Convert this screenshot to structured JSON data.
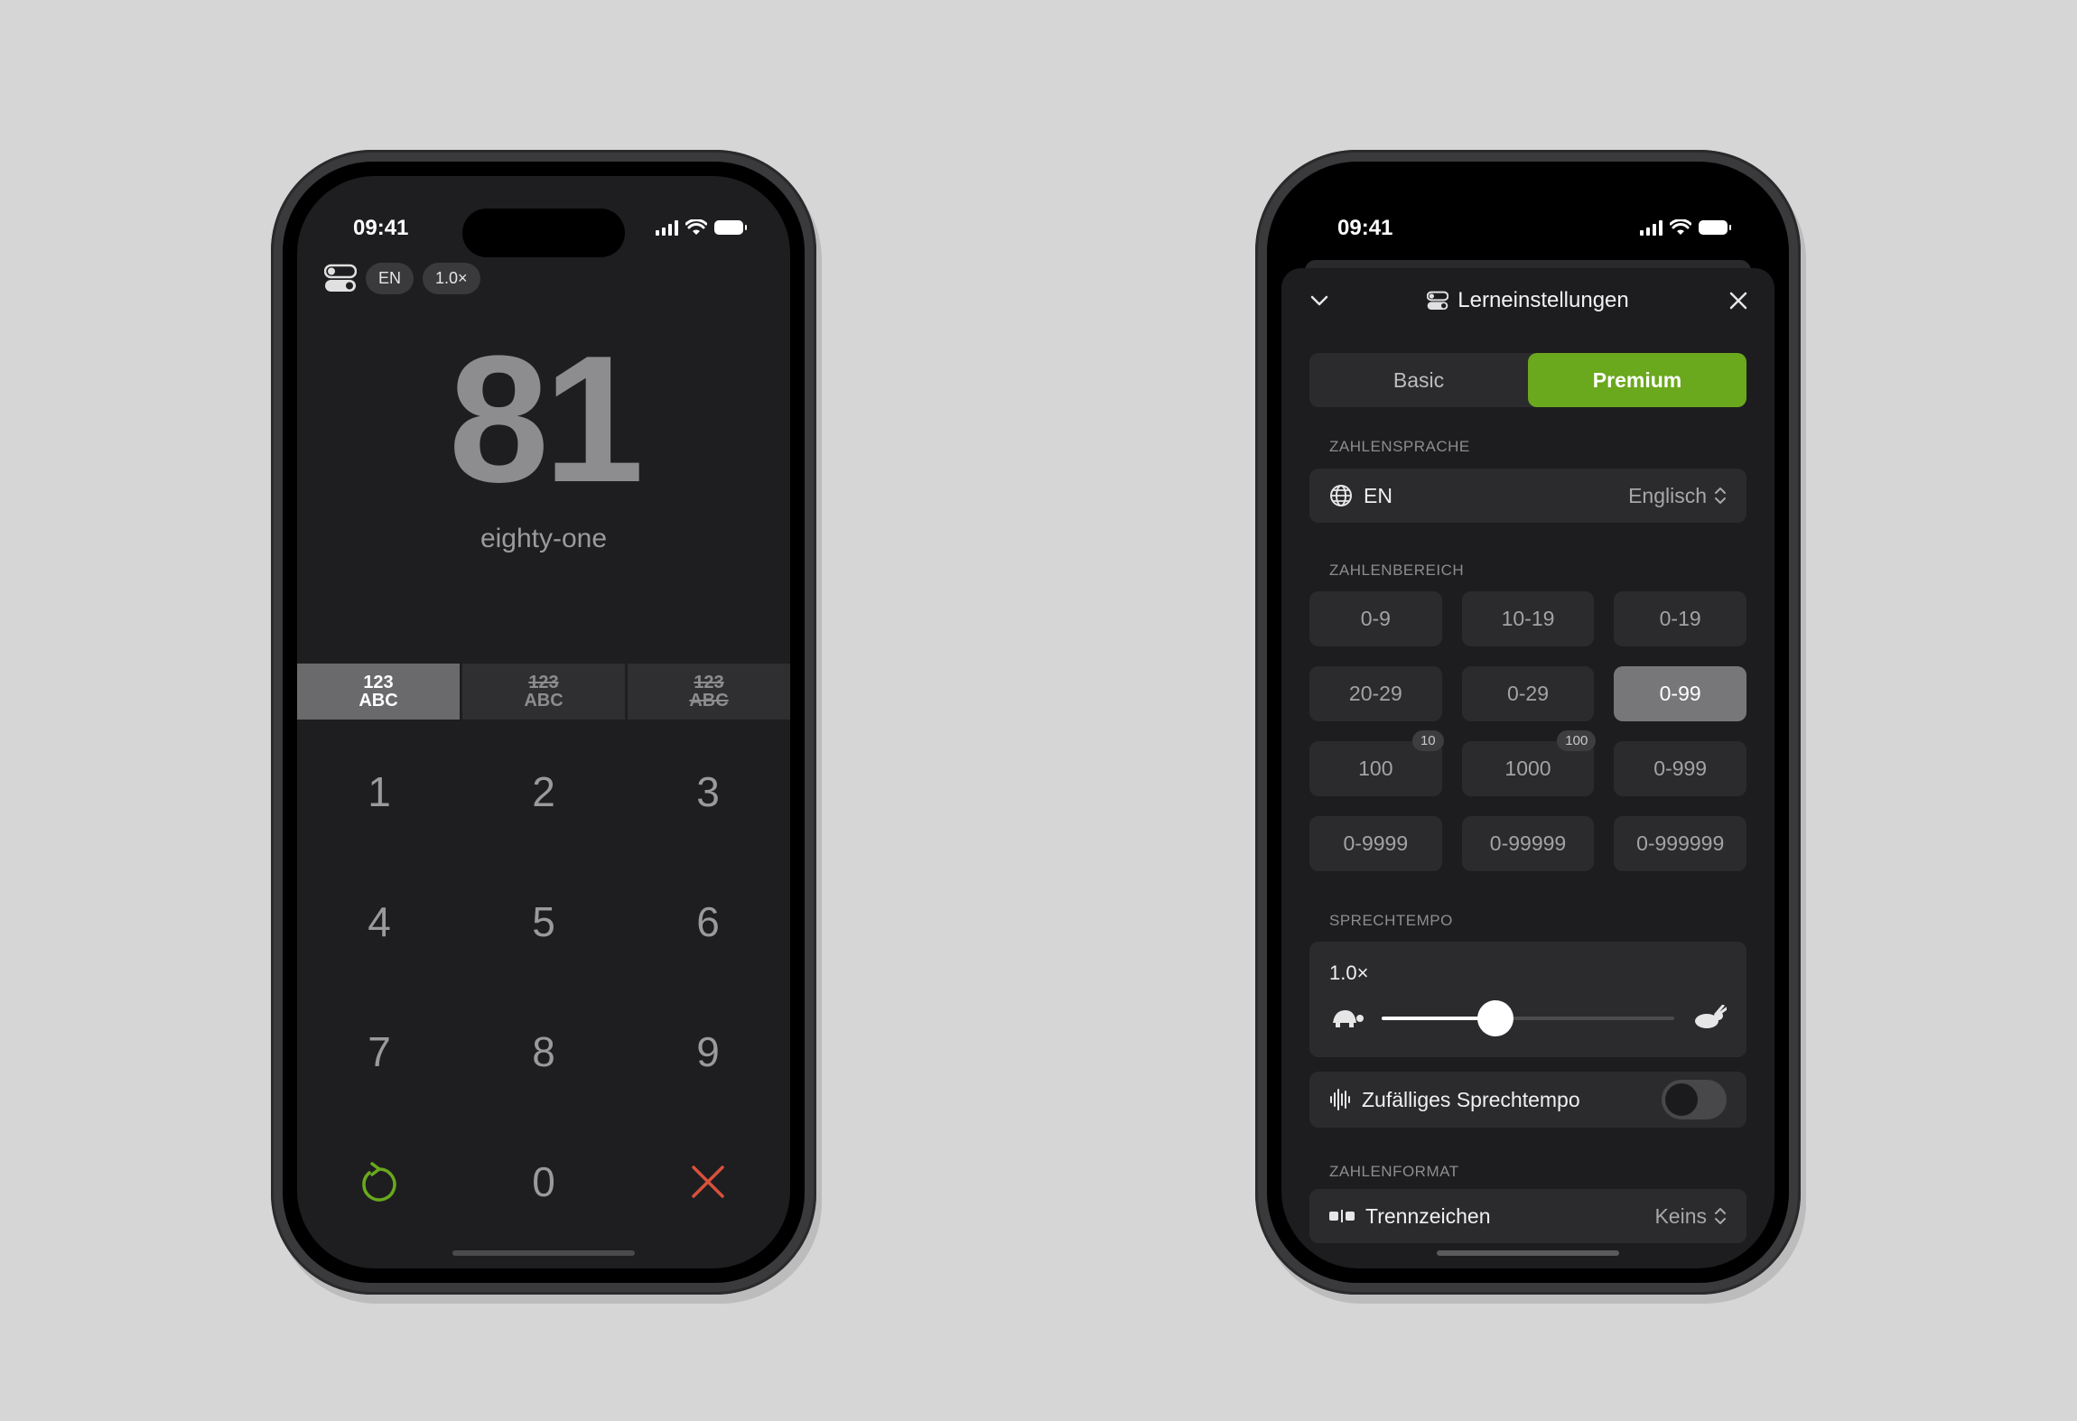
{
  "left_phone": {
    "status": {
      "time": "09:41"
    },
    "top_controls": {
      "lang": "EN",
      "speed": "1.0×"
    },
    "number": "81",
    "number_words": "eighty-one",
    "modes": [
      {
        "top": "123",
        "bottom": "ABC",
        "top_strike": false,
        "bottom_strike": false,
        "active": true
      },
      {
        "top": "123",
        "bottom": "ABC",
        "top_strike": true,
        "bottom_strike": false,
        "active": false
      },
      {
        "top": "123",
        "bottom": "ABC",
        "top_strike": true,
        "bottom_strike": true,
        "active": false
      }
    ],
    "keys": [
      "1",
      "2",
      "3",
      "4",
      "5",
      "6",
      "7",
      "8",
      "9",
      "0"
    ]
  },
  "right_phone": {
    "status": {
      "time": "09:41"
    },
    "sheet_title": "Lerneinstellungen",
    "segments": [
      "Basic",
      "Premium"
    ],
    "active_segment": "Premium",
    "section_language": "ZAHLENSPRACHE",
    "language_code": "EN",
    "language_name": "Englisch",
    "section_range": "ZAHLENBEREICH",
    "ranges": [
      {
        "label": "0-9",
        "badge": ""
      },
      {
        "label": "10-19",
        "badge": ""
      },
      {
        "label": "0-19",
        "badge": ""
      },
      {
        "label": "20-29",
        "badge": ""
      },
      {
        "label": "0-29",
        "badge": ""
      },
      {
        "label": "0-99",
        "badge": ""
      },
      {
        "label": "100",
        "badge": "10"
      },
      {
        "label": "1000",
        "badge": "100"
      },
      {
        "label": "0-999",
        "badge": ""
      },
      {
        "label": "0-9999",
        "badge": ""
      },
      {
        "label": "0-99999",
        "badge": ""
      },
      {
        "label": "0-999999",
        "badge": ""
      }
    ],
    "selected_range": "0-99",
    "section_tempo": "SPRECHTEMPO",
    "tempo_value": "1.0×",
    "tempo_slider_fraction": 0.39,
    "random_tempo_label": "Zufälliges Sprechtempo",
    "random_tempo_on": false,
    "section_format": "ZAHLENFORMAT",
    "separator_label": "Trennzeichen",
    "separator_value": "Keins"
  },
  "colors": {
    "accent_green": "#6aa81d",
    "delete_red": "#d9513c",
    "background": "#d6d6d6"
  }
}
